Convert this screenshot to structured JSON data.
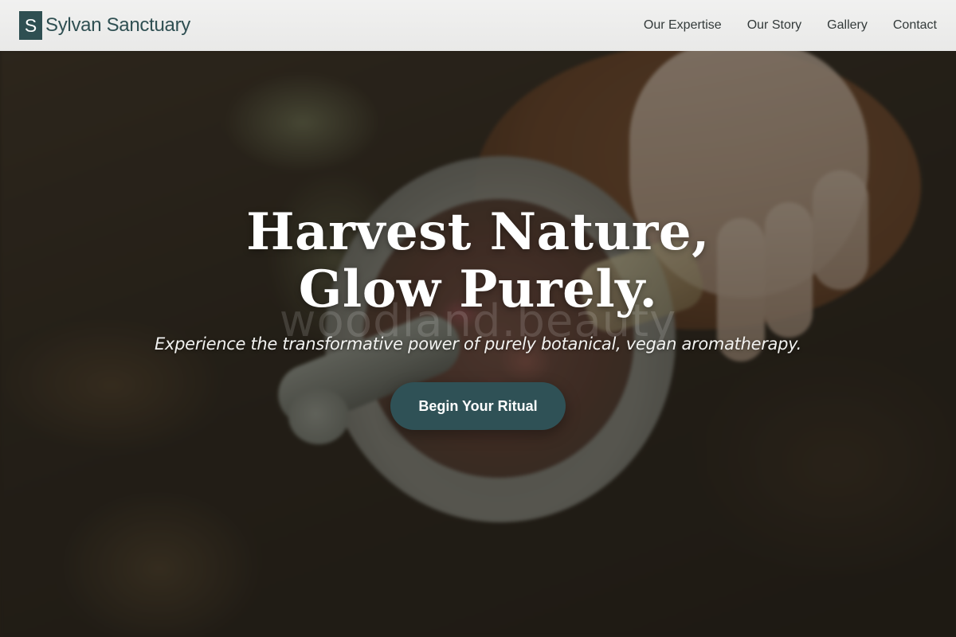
{
  "header": {
    "brand_mark": "S",
    "brand_name": "Sylvan Sanctuary",
    "nav": [
      {
        "label": "Our Expertise"
      },
      {
        "label": "Our Story"
      },
      {
        "label": "Gallery"
      },
      {
        "label": "Contact"
      }
    ]
  },
  "hero": {
    "title": "Harvest Nature, Glow Purely.",
    "watermark": "woodland.beauty",
    "subtitle": "Experience the transformative power of purely botanical, vegan aromatherapy.",
    "cta_label": "Begin Your Ritual"
  },
  "colors": {
    "brand": "#2f4f52",
    "cta_background": "#2f5156",
    "header_background": "#ececeb"
  }
}
